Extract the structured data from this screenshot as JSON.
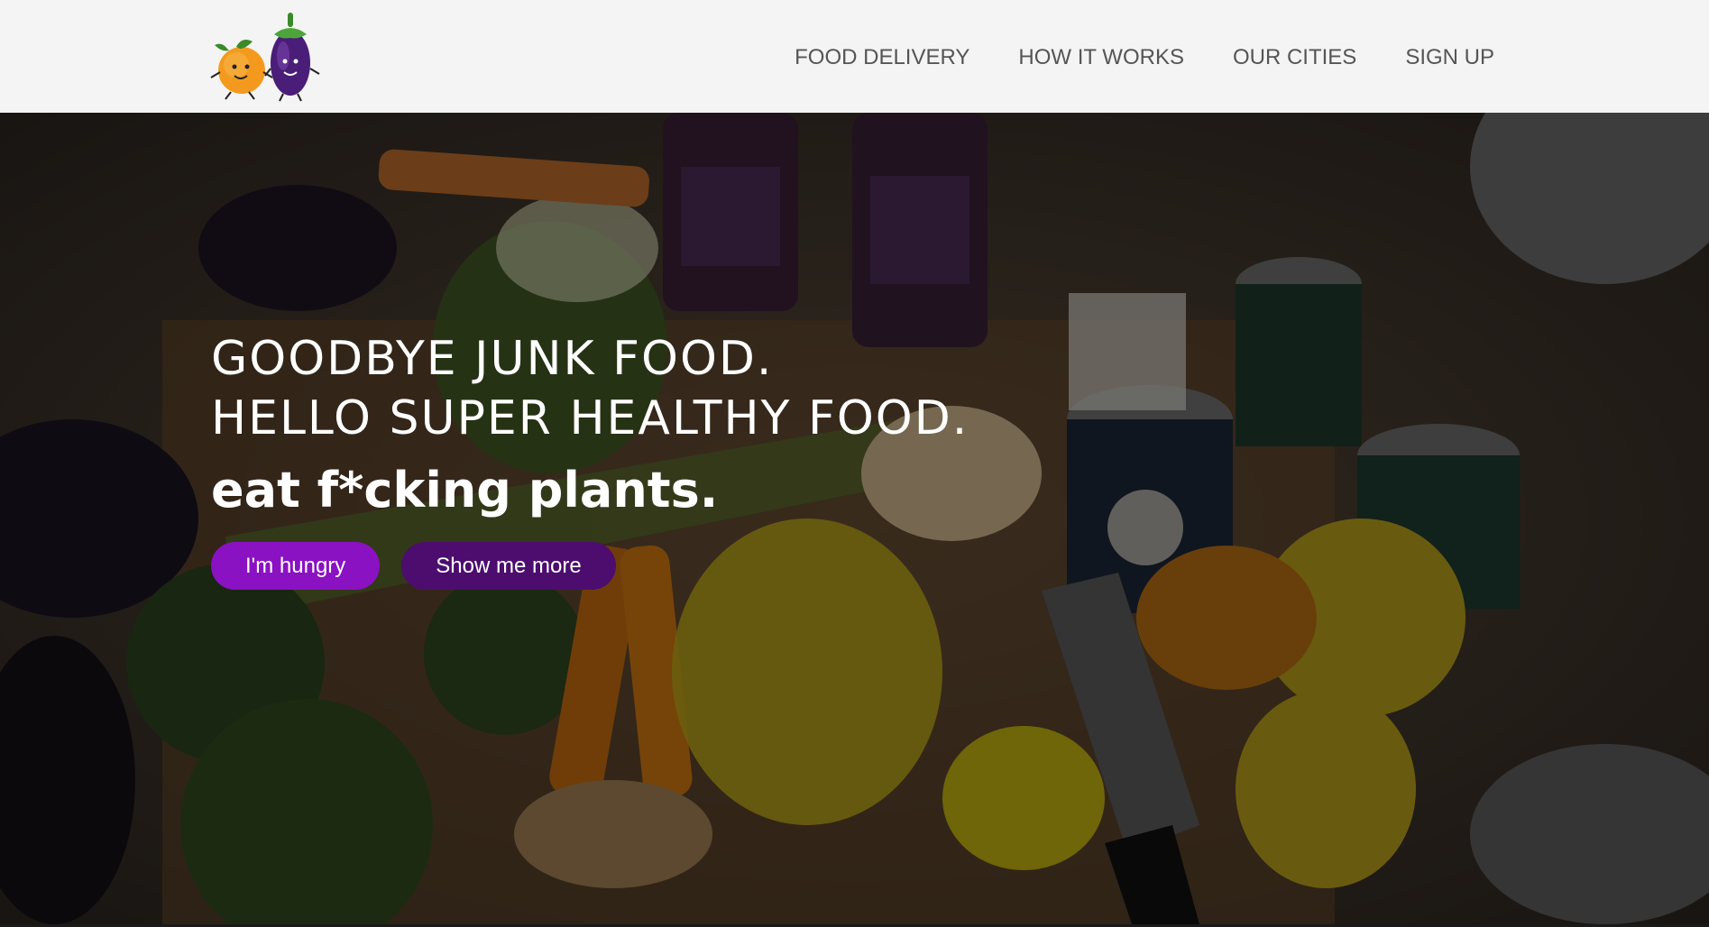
{
  "header": {
    "logo_icon": "peach-and-eggplant-logo-icon",
    "nav": [
      {
        "label": "FOOD DELIVERY"
      },
      {
        "label": "HOW IT WORKS"
      },
      {
        "label": "OUR CITIES"
      },
      {
        "label": "SIGN UP"
      }
    ]
  },
  "hero": {
    "headline_line1": "GOODBYE JUNK FOOD.",
    "headline_line2": "HELLO SUPER HEALTHY FOOD.",
    "tagline": "eat f*cking plants.",
    "primary_button": "I'm hungry",
    "secondary_button": "Show me more",
    "background_image": "vegetables-and-organic-cans-photo"
  },
  "colors": {
    "primary_button": "#8a12c2",
    "secondary_button": "#4c0d6e",
    "nav_text": "#555555",
    "header_bg": "#f4f4f4"
  }
}
